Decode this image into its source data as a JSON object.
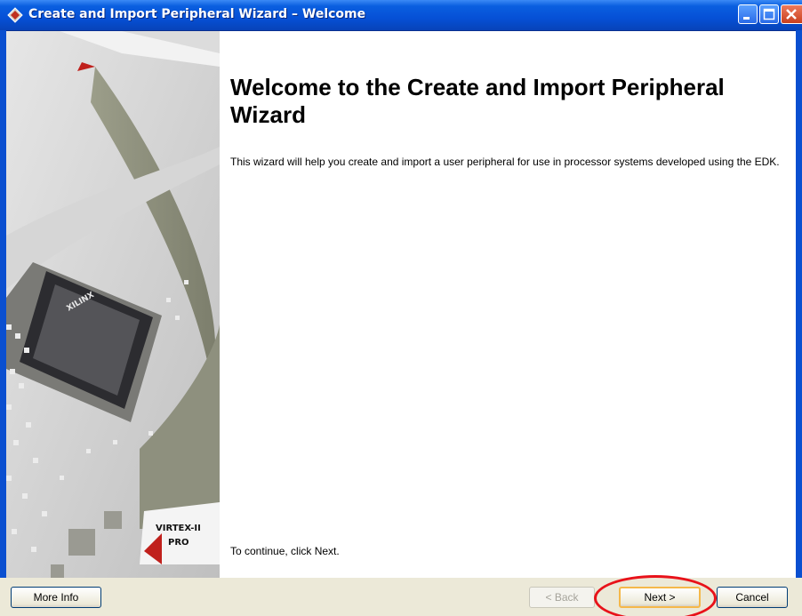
{
  "window": {
    "title": "Create and Import Peripheral Wizard – Welcome",
    "icon": "wizard-app-icon",
    "controls": [
      "minimize-icon",
      "maximize-icon",
      "close-icon"
    ]
  },
  "side_image": {
    "chip_label_1": "VIRTEX-II",
    "chip_label_2": "PRO",
    "brand": "XILINX"
  },
  "content": {
    "heading": "Welcome to the Create and Import Peripheral Wizard",
    "description": "This wizard will help you create and import a user peripheral for use in processor systems developed using the EDK.",
    "continue_hint": "To continue, click Next."
  },
  "footer": {
    "more_info": "More Info",
    "back": "< Back",
    "next": "Next >",
    "cancel": "Cancel"
  },
  "colors": {
    "title_bar": "#0650d6",
    "annotation_circle": "#e8121a",
    "default_button_border": "#f5b84a"
  }
}
